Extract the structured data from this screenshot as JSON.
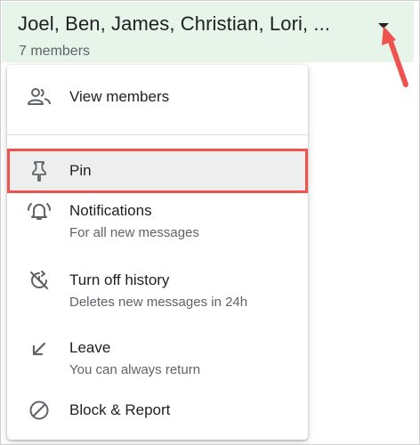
{
  "header": {
    "title": "Joel, Ben, James, Christian, Lori, ...",
    "subtitle": "7 members",
    "dropdown_icon": "arrow-drop-down",
    "background_color": "#e6f4ea"
  },
  "annotation": {
    "arrow_color": "#ef5350",
    "highlight_color": "#ef5350"
  },
  "menu": {
    "items": [
      {
        "icon": "people-icon",
        "label": "View members"
      },
      {
        "icon": "pin-icon",
        "label": "Pin",
        "highlighted": true
      },
      {
        "icon": "bell-icon",
        "label": "Notifications",
        "sublabel": "For all new messages"
      },
      {
        "icon": "history-off-icon",
        "label": "Turn off history",
        "sublabel": "Deletes new messages in 24h"
      },
      {
        "icon": "leave-arrow-icon",
        "label": "Leave",
        "sublabel": "You can always return"
      },
      {
        "icon": "block-icon",
        "label": "Block & Report"
      }
    ]
  }
}
